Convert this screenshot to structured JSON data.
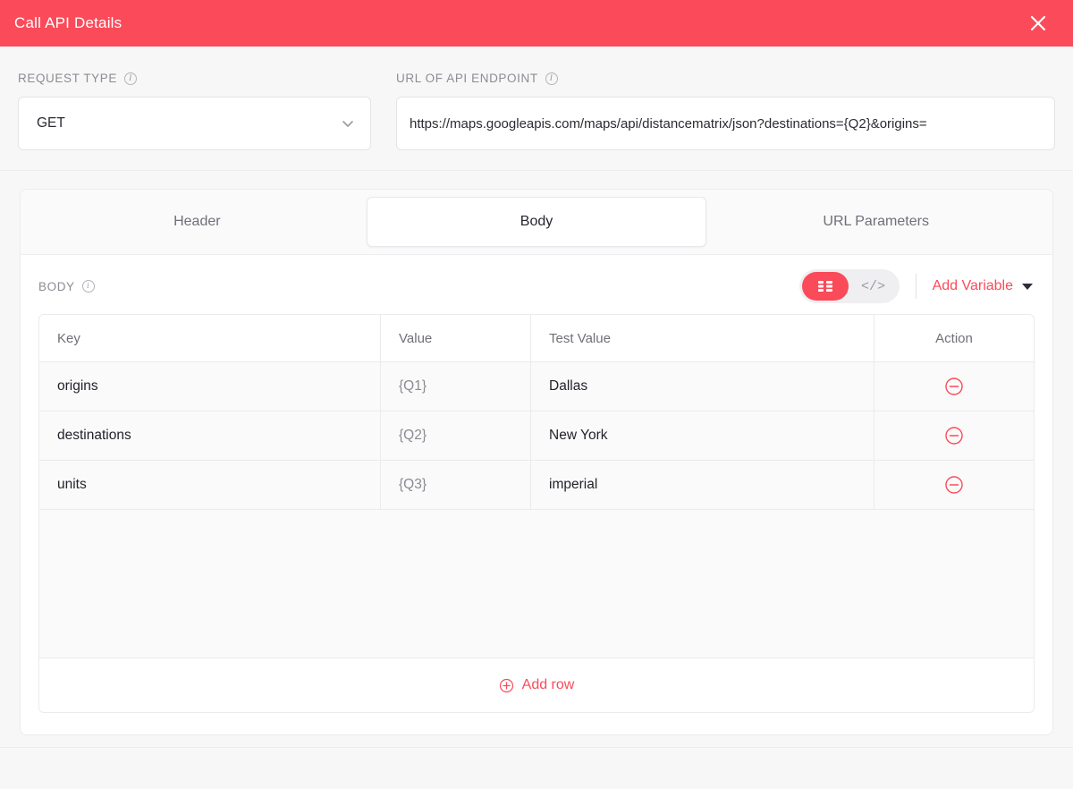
{
  "titlebar": {
    "title": "Call API Details",
    "close_icon": "close-icon"
  },
  "form": {
    "request_type": {
      "label": "REQUEST TYPE",
      "info_icon": "info-icon",
      "value": "GET",
      "chevron_icon": "chevron-down-icon"
    },
    "endpoint": {
      "label": "URL OF API ENDPOINT",
      "info_icon": "info-icon",
      "value": "https://maps.googleapis.com/maps/api/distancematrix/json?destinations={Q2}&origins="
    }
  },
  "tabs": [
    {
      "label": "Header",
      "active": false
    },
    {
      "label": "Body",
      "active": true
    },
    {
      "label": "URL Parameters",
      "active": false
    }
  ],
  "body_section": {
    "label": "BODY",
    "info_icon": "info-icon",
    "view_toggle": {
      "table_icon": "table-view-icon",
      "code_icon": "code-view-icon",
      "code_glyph": "</>",
      "active": "table"
    },
    "add_variable": {
      "label": "Add Variable",
      "caret_icon": "caret-down-icon"
    },
    "table": {
      "columns": [
        "Key",
        "Value",
        "Test Value",
        "Action"
      ],
      "rows": [
        {
          "key": "origins",
          "value": "{Q1}",
          "test_value": "Dallas",
          "action_icon": "remove-circle-icon"
        },
        {
          "key": "destinations",
          "value": "{Q2}",
          "test_value": "New York",
          "action_icon": "remove-circle-icon"
        },
        {
          "key": "units",
          "value": "{Q3}",
          "test_value": "imperial",
          "action_icon": "remove-circle-icon"
        }
      ],
      "add_row": {
        "label": "Add row",
        "icon": "add-circle-icon"
      }
    }
  },
  "colors": {
    "accent": "#fb4a59",
    "page_background": "#f7f7f8",
    "card_background": "#ffffff",
    "table_row_background": "#fafafa",
    "border": "#ebebee",
    "label_text": "#8c8c94",
    "primary_text": "#23232b"
  }
}
